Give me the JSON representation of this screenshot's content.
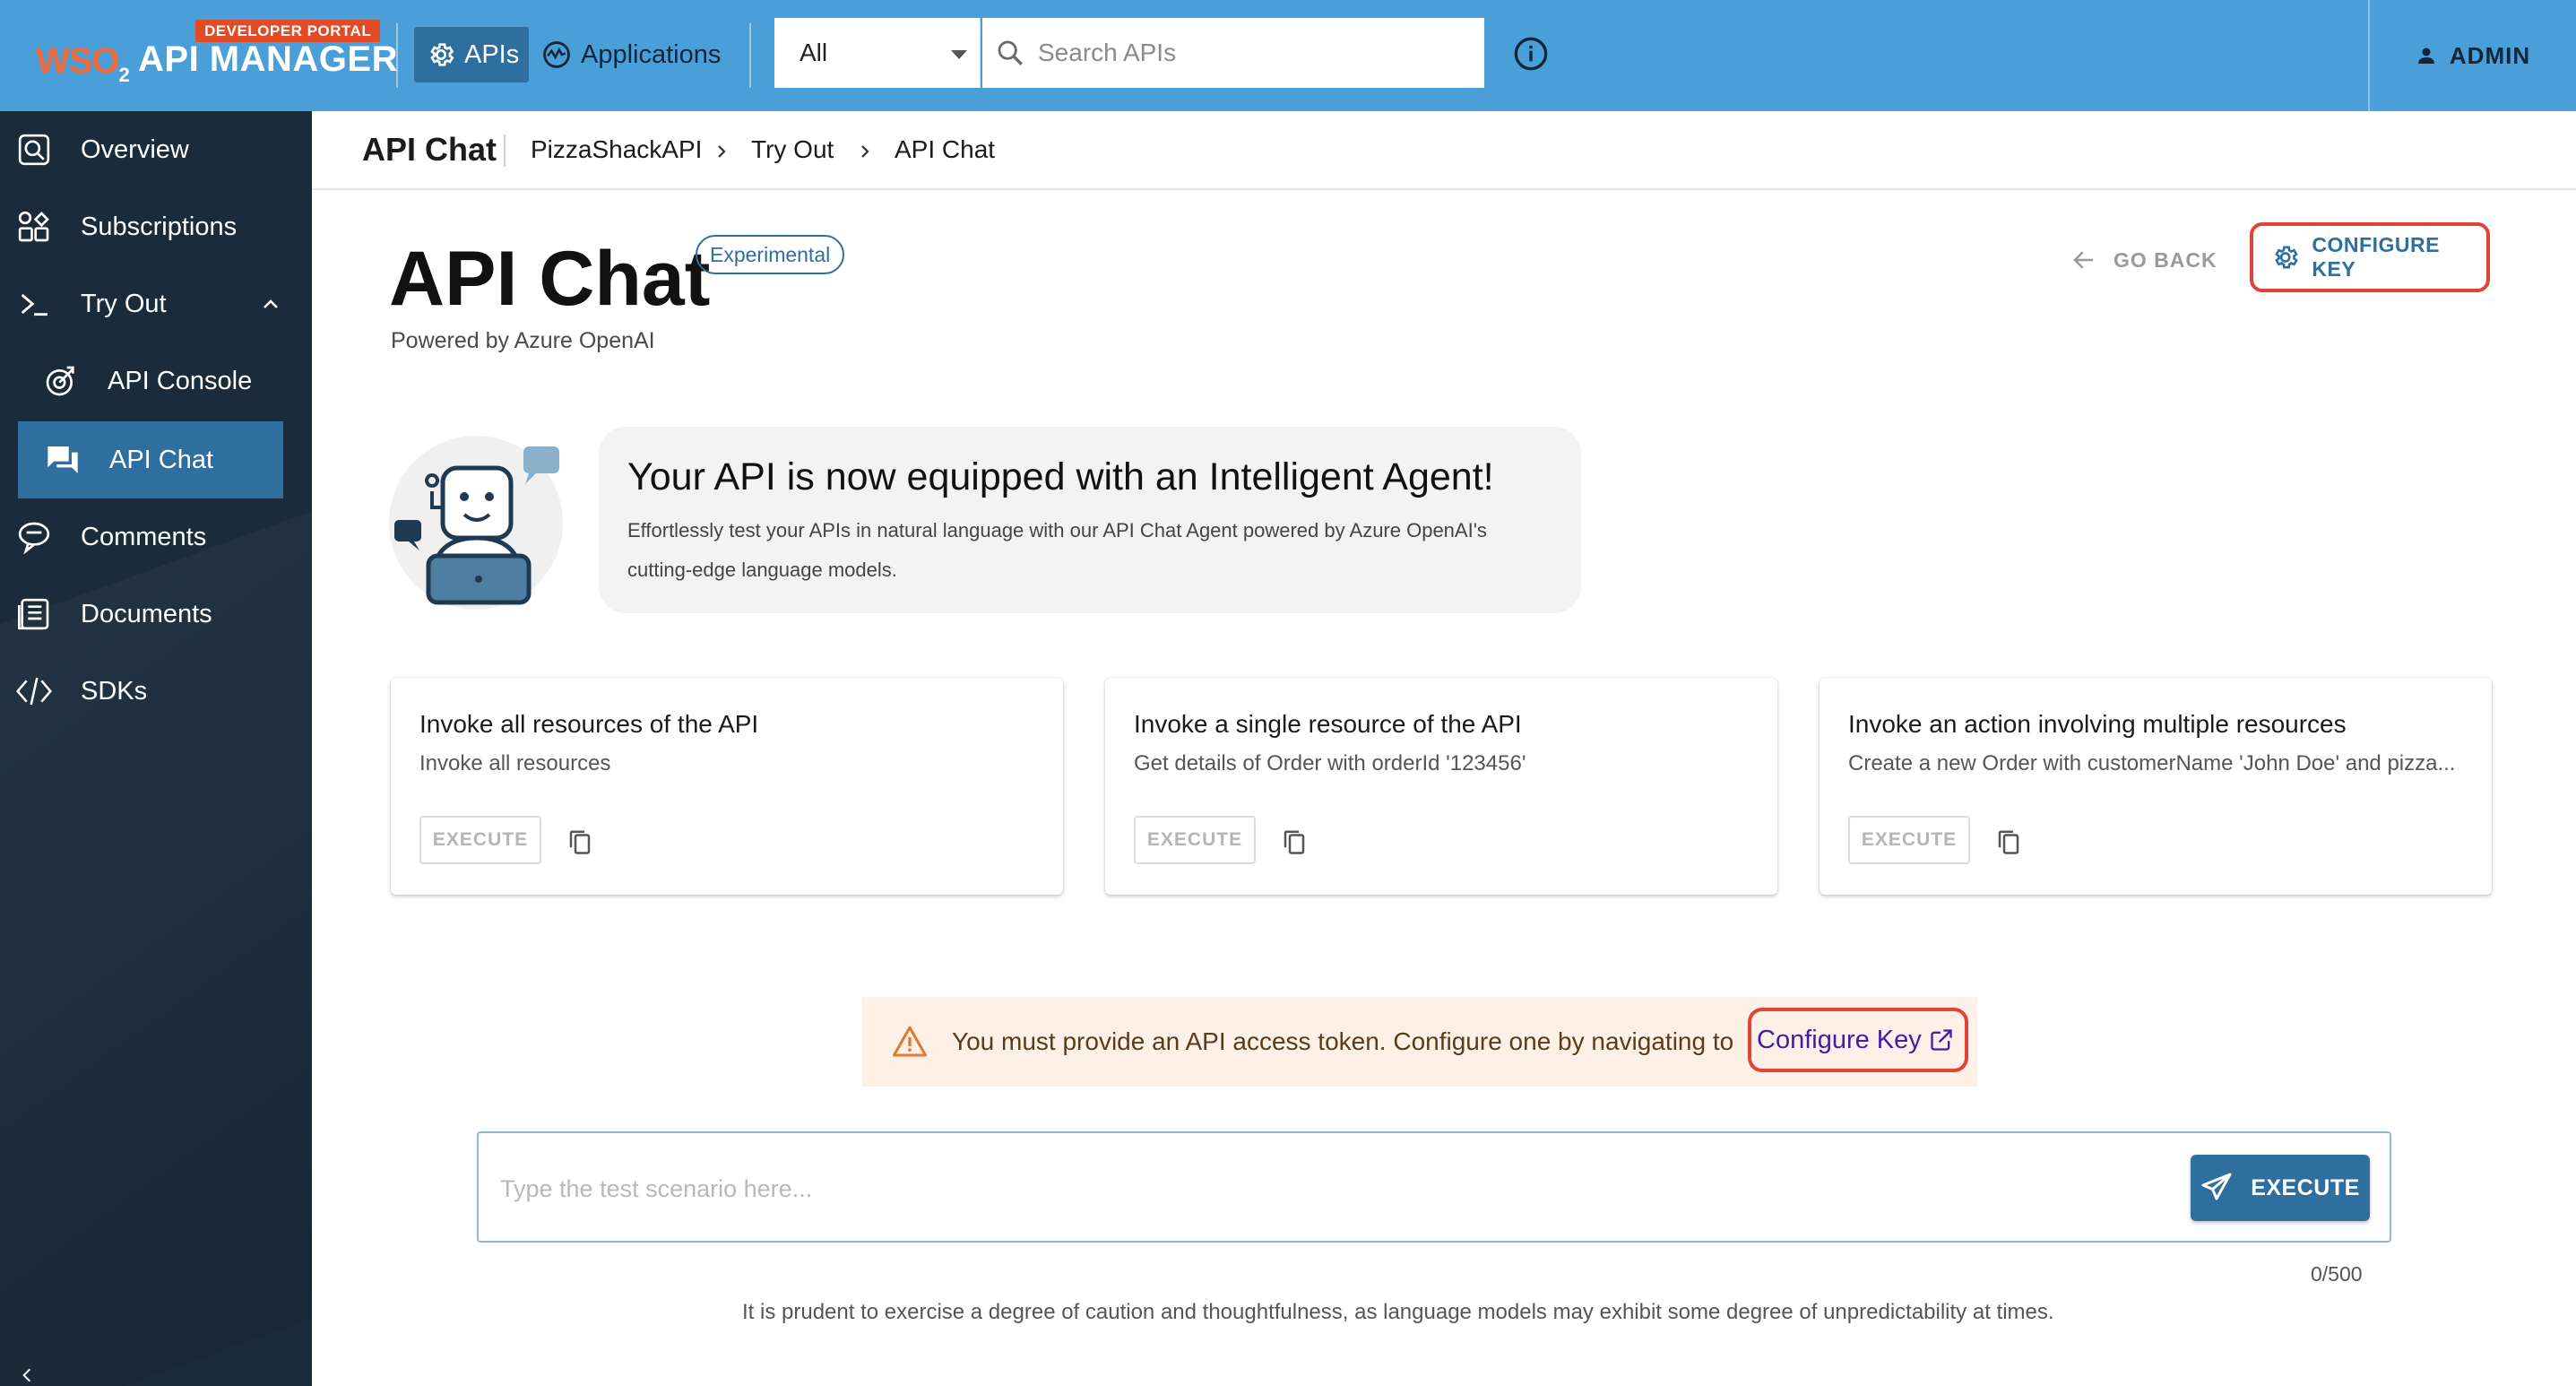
{
  "header": {
    "badge": "DEVELOPER PORTAL",
    "brand_left": "WSO",
    "brand_sub": "2",
    "app_name": "API MANAGER",
    "nav": [
      {
        "label": "APIs",
        "icon": "gear-icon",
        "active": true
      },
      {
        "label": "Applications",
        "icon": "applications-icon",
        "active": false
      }
    ],
    "search_scope": "All",
    "search_placeholder": "Search APIs",
    "user": "ADMIN"
  },
  "sidebar": {
    "items": [
      {
        "label": "Overview",
        "icon": "overview-icon"
      },
      {
        "label": "Subscriptions",
        "icon": "subscriptions-icon"
      },
      {
        "label": "Try Out",
        "icon": "terminal-icon"
      },
      {
        "label": "API Console",
        "icon": "target-icon"
      },
      {
        "label": "API Chat",
        "icon": "chat-icon"
      },
      {
        "label": "Comments",
        "icon": "comment-icon"
      },
      {
        "label": "Documents",
        "icon": "documents-icon"
      },
      {
        "label": "SDKs",
        "icon": "code-icon"
      }
    ]
  },
  "breadcrumb": {
    "title": "API Chat",
    "items": [
      "PizzaShackAPI",
      "Try Out",
      "API Chat"
    ]
  },
  "page": {
    "title": "API Chat",
    "chip": "Experimental",
    "subtitle": "Powered by Azure OpenAI",
    "go_back": "GO BACK",
    "configure_key": "CONFIGURE KEY"
  },
  "intro": {
    "title": "Your API is now equipped with an Intelligent Agent!",
    "text": "Effortlessly test your APIs in natural language with our API Chat Agent powered by Azure OpenAI's cutting-edge language models."
  },
  "samples": [
    {
      "title": "Invoke all resources of the API",
      "subtitle": "Invoke all resources",
      "button": "EXECUTE"
    },
    {
      "title": "Invoke a single resource of the API",
      "subtitle": "Get details of Order with orderId '123456'",
      "button": "EXECUTE"
    },
    {
      "title": "Invoke an action involving multiple resources",
      "subtitle": "Create a new Order with customerName 'John Doe' and pizza...",
      "button": "EXECUTE"
    }
  ],
  "warning": {
    "text": "You must provide an API access token. Configure one by navigating to",
    "link": "Configure Key"
  },
  "chat_input": {
    "placeholder": "Type the test scenario here...",
    "value": "",
    "button": "EXECUTE",
    "counter": "0/500"
  },
  "disclaimer": "It is prudent to exercise a degree of caution and thoughtfulness, as language models may exhibit some degree of unpredictability at times.",
  "colors": {
    "topbar": "#4b9fd8",
    "sidebar": "#1a2b3c",
    "accent": "#2f6f9f",
    "highlight": "#e04436",
    "warning_bg": "#fdf0e6"
  }
}
